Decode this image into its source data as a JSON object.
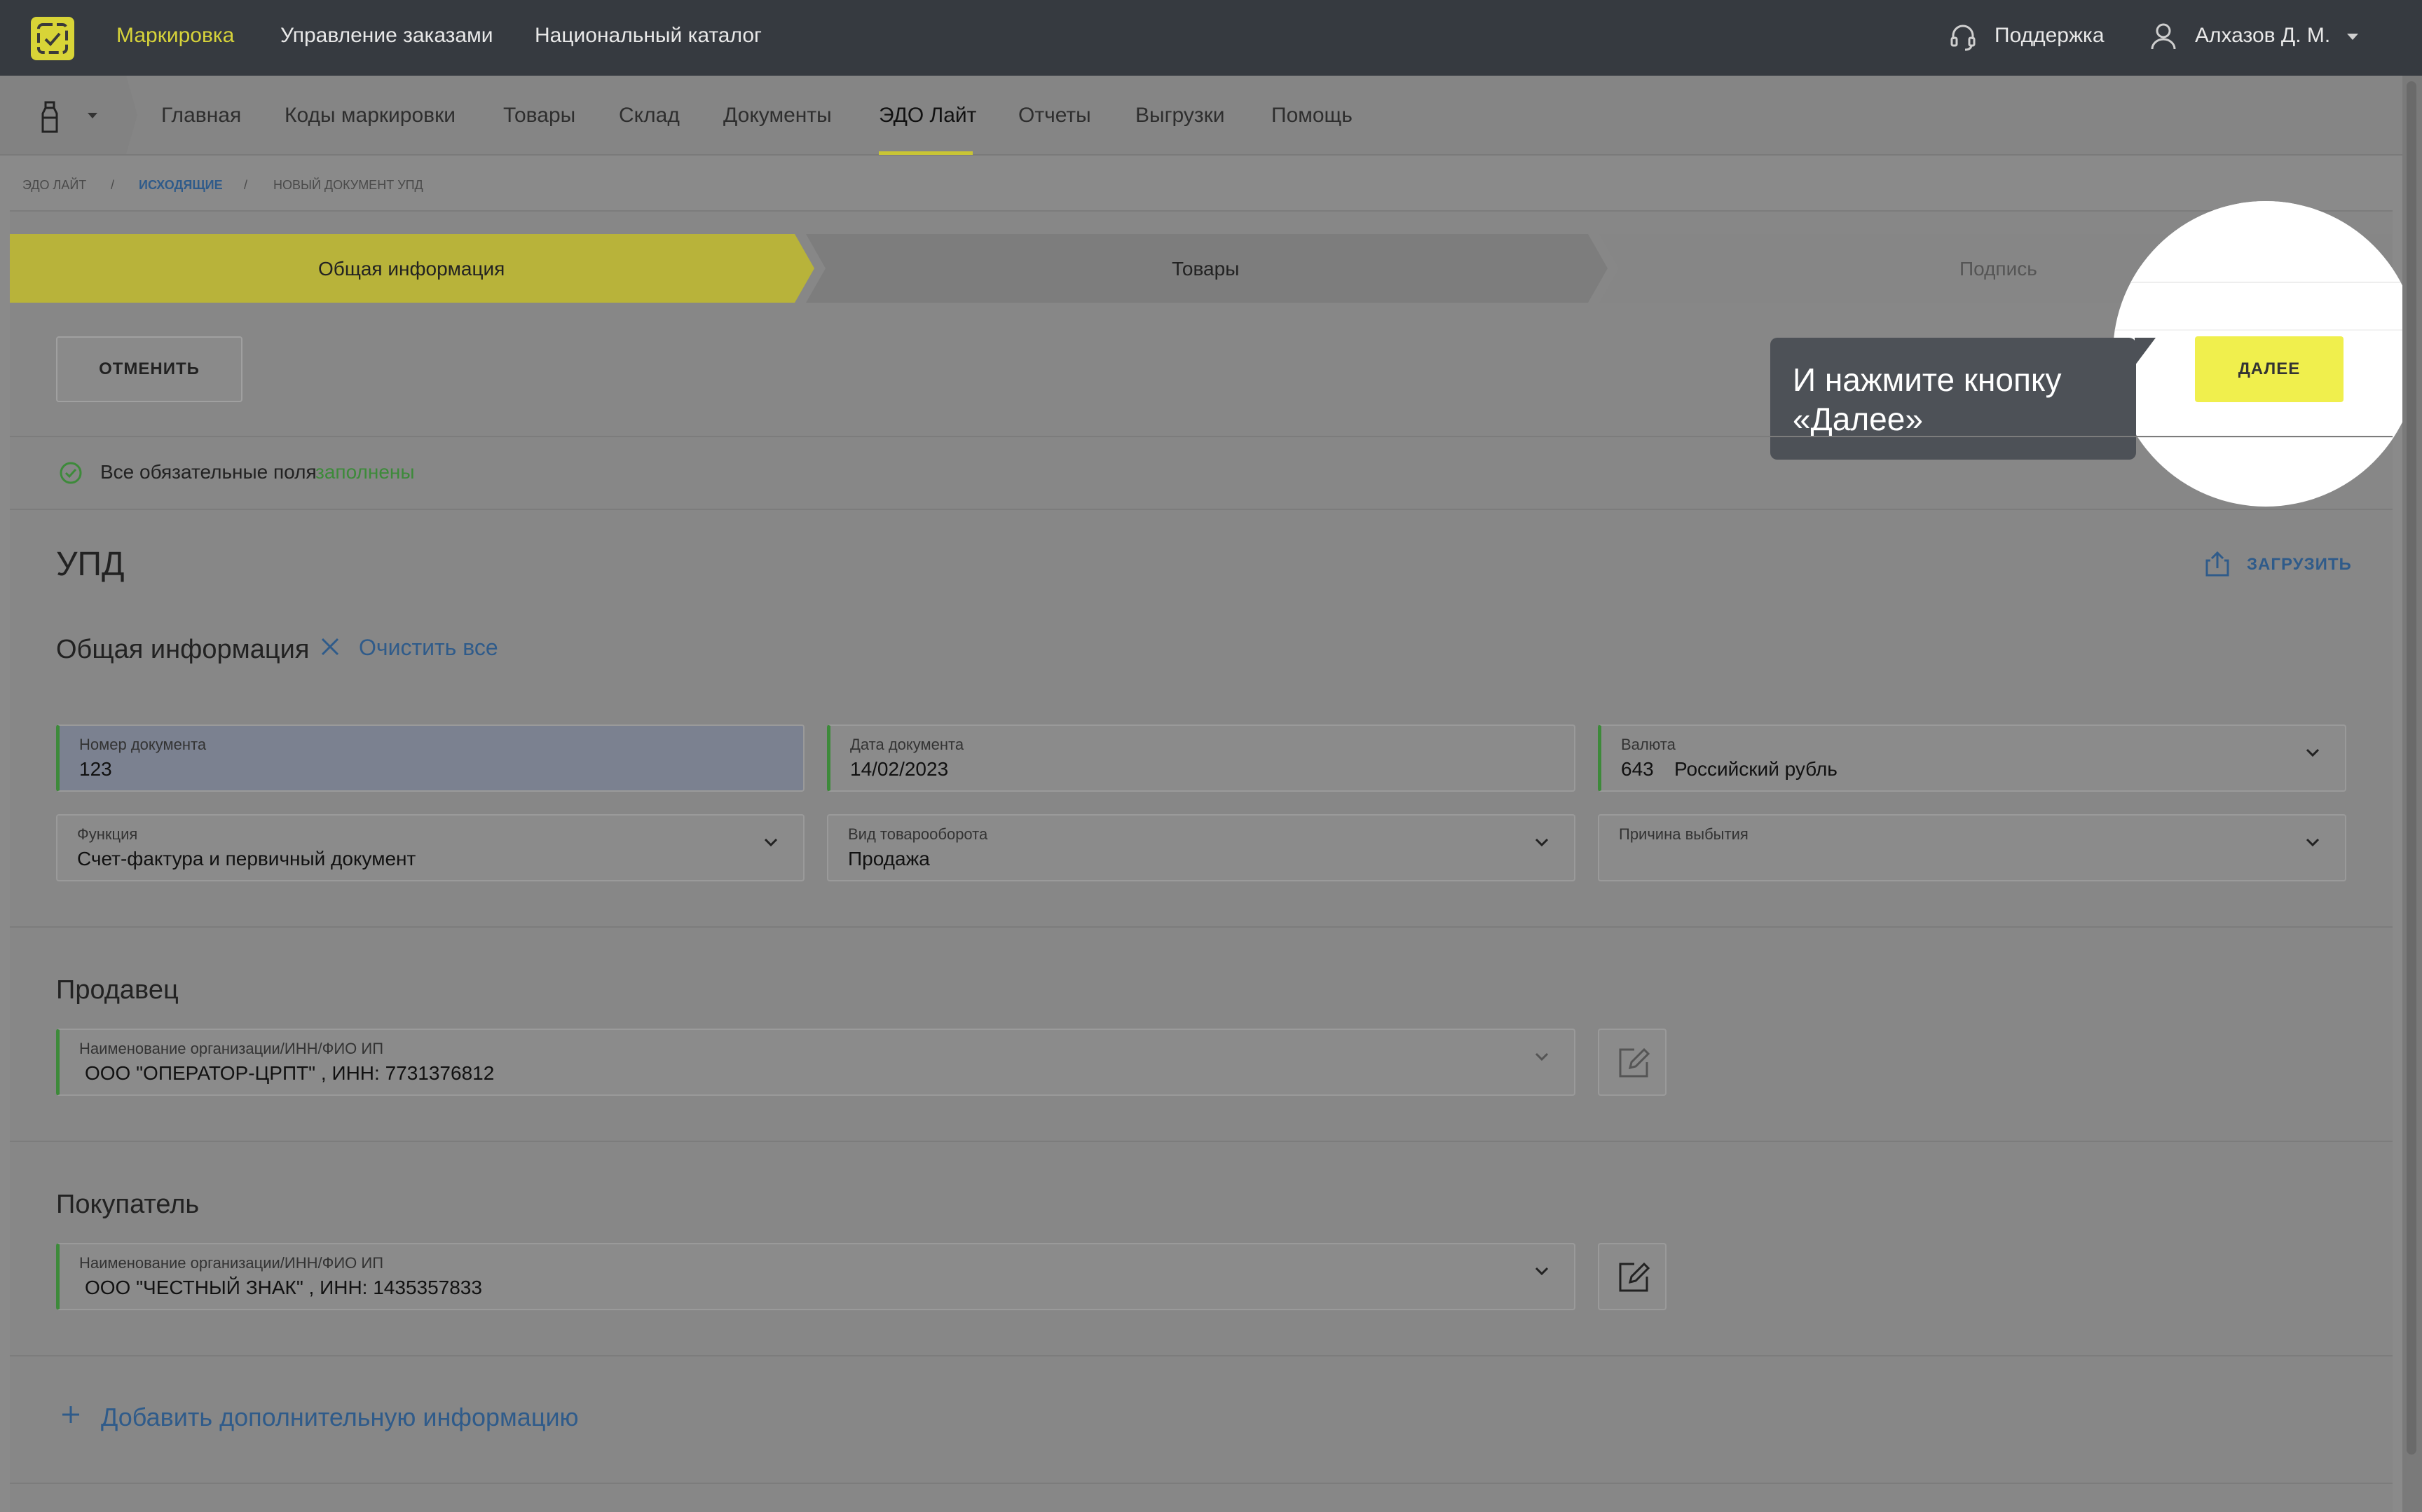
{
  "topbar": {
    "nav": [
      "Маркировка",
      "Управление заказами",
      "Национальный каталог"
    ],
    "support": "Поддержка",
    "user": "Алхазов Д. М."
  },
  "subnav": {
    "items": [
      "Главная",
      "Коды маркировки",
      "Товары",
      "Склад",
      "Документы",
      "ЭДО Лайт",
      "Отчеты",
      "Выгрузки",
      "Помощь"
    ],
    "active": "ЭДО Лайт"
  },
  "breadcrumb": [
    "эдо лайт",
    "исходящие",
    "новый документ упд"
  ],
  "steps": [
    "Общая информация",
    "Товары",
    "Подпись"
  ],
  "buttons": {
    "cancel": "ОТМЕНИТЬ",
    "next": "ДАЛЕЕ",
    "upload": "ЗАГРУЗИТЬ"
  },
  "tooltip": "И нажмите кнопку «Далее»",
  "status": {
    "text": "Все обязательные поля",
    "link": "заполнены"
  },
  "document": {
    "title": "УПД",
    "section": "Общая информация",
    "clear_all": "Очистить все",
    "fields": {
      "number": {
        "label": "Номер документа",
        "value": "123"
      },
      "date": {
        "label": "Дата документа",
        "value": "14/02/2023"
      },
      "currency": {
        "label": "Валюта",
        "code": "643",
        "value": "Российский рубль"
      },
      "function": {
        "label": "Функция",
        "value": "Счет-фактура и первичный документ"
      },
      "turnover": {
        "label": "Вид товарооборота",
        "value": "Продажа"
      },
      "reason": {
        "label": "Причина выбытия",
        "value": ""
      }
    }
  },
  "seller": {
    "title": "Продавец",
    "label": "Наименование организации/ИНН/ФИО ИП",
    "value": "ООО \"ОПЕРАТОР-ЦРПТ\" , ИНН: 7731376812"
  },
  "buyer": {
    "title": "Покупатель",
    "label": "Наименование организации/ИНН/ФИО ИП",
    "value": "ООО \"ЧЕСТНЫЙ ЗНАК\" , ИНН: 1435357833"
  },
  "add_info": "Добавить дополнительную информацию",
  "colors": {
    "accent_yellow": "#f0ef4d",
    "nav_active": "#d7d33a",
    "success_green": "#3d8a3a",
    "link_blue": "#2f5b8a"
  }
}
